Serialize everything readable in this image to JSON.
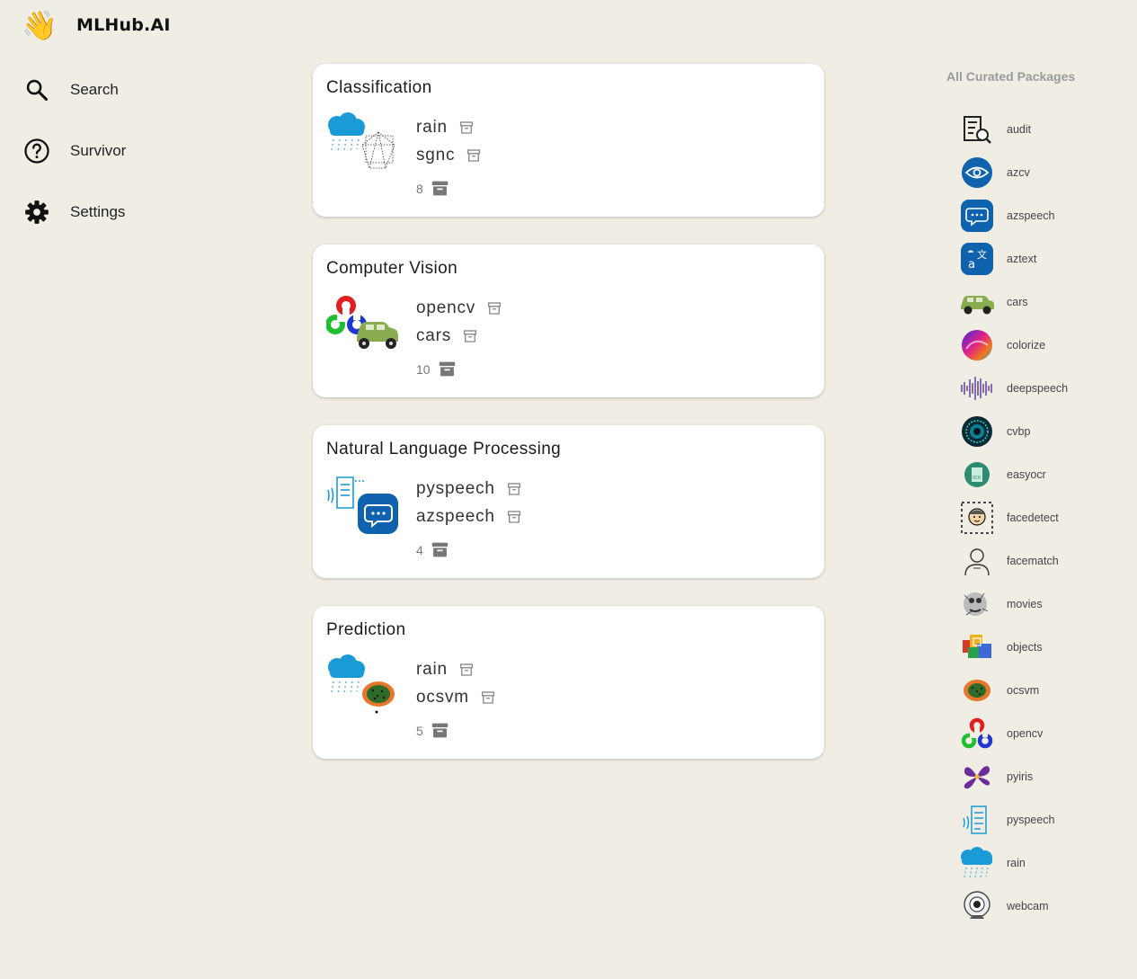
{
  "app": {
    "title": "MLHub.AI",
    "logo_emoji": "👋"
  },
  "nav": [
    {
      "label": "Search",
      "icon": "search-icon"
    },
    {
      "label": "Survivor",
      "icon": "help-circle-icon"
    },
    {
      "label": "Settings",
      "icon": "gear-icon"
    }
  ],
  "categories": [
    {
      "title": "Classification",
      "packages": [
        "rain",
        "sgnc"
      ],
      "count": "8",
      "image": "rain-sgnc-image"
    },
    {
      "title": "Computer Vision",
      "packages": [
        "opencv",
        "cars"
      ],
      "count": "10",
      "image": "opencv-cars-image"
    },
    {
      "title": "Natural Language Processing",
      "packages": [
        "pyspeech",
        "azspeech"
      ],
      "count": "4",
      "image": "pyspeech-azspeech-image"
    },
    {
      "title": "Prediction",
      "packages": [
        "rain",
        "ocsvm"
      ],
      "count": "5",
      "image": "rain-ocsvm-image"
    }
  ],
  "curated": {
    "title": "All Curated Packages",
    "items": [
      "audit",
      "azcv",
      "azspeech",
      "aztext",
      "cars",
      "colorize",
      "deepspeech",
      "cvbp",
      "easyocr",
      "facedetect",
      "facematch",
      "movies",
      "objects",
      "ocsvm",
      "opencv",
      "pyiris",
      "pyspeech",
      "rain",
      "webcam"
    ]
  },
  "colors": {
    "background": "#f0eee4",
    "card": "#ffffff",
    "muted": "#9a9a9a",
    "azure": "#0f62ad",
    "rain": "#1a9ad6"
  }
}
